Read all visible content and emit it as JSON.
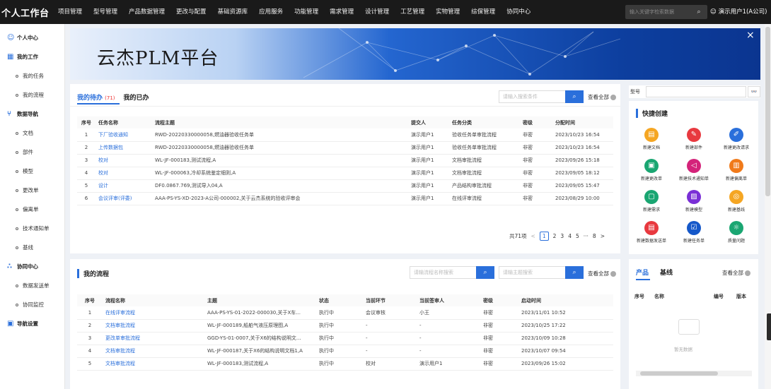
{
  "app": {
    "brand": "个人工作台",
    "user": "演示用户1(A公司)"
  },
  "nav": [
    "项目管理",
    "型号管理",
    "产品数据管理",
    "更改与配置",
    "基础资源库",
    "应用服务",
    "功能管理",
    "需求管理",
    "设计管理",
    "工艺管理",
    "实物管理",
    "综保管理",
    "协同中心"
  ],
  "search": {
    "placeholder": "输入关键字检索数据"
  },
  "sidebar": [
    {
      "label": "个人中心",
      "type": "group",
      "icon": "user-icon"
    },
    {
      "label": "我的工作",
      "type": "group",
      "icon": "calendar-icon"
    },
    {
      "label": "我的任务",
      "type": "sub"
    },
    {
      "label": "我的流程",
      "type": "sub"
    },
    {
      "label": "数据导航",
      "type": "group",
      "icon": "tree-icon"
    },
    {
      "label": "文档",
      "type": "sub"
    },
    {
      "label": "部件",
      "type": "sub"
    },
    {
      "label": "模型",
      "type": "sub"
    },
    {
      "label": "更改单",
      "type": "sub"
    },
    {
      "label": "偏离单",
      "type": "sub"
    },
    {
      "label": "技术通知单",
      "type": "sub"
    },
    {
      "label": "基线",
      "type": "sub"
    },
    {
      "label": "协同中心",
      "type": "group",
      "icon": "share-icon"
    },
    {
      "label": "数据发送单",
      "type": "sub"
    },
    {
      "label": "协同监控",
      "type": "sub"
    },
    {
      "label": "导航设置",
      "type": "group",
      "icon": "grid-icon"
    }
  ],
  "banner": {
    "title": "云杰PLM平台",
    "close": "×"
  },
  "todo": {
    "tab_todo": "我的待办",
    "todo_count": "(71)",
    "tab_done": "我的已办",
    "search_placeholder": "请输入搜索条件",
    "view_all": "查看全部",
    "columns": [
      "序号",
      "任务名称",
      "流程主题",
      "提交人",
      "任务分类",
      "密级",
      "分配时间"
    ],
    "rows": [
      [
        "1",
        "下厂验收通知",
        "RWD-20220330000058,燃油器验收任务单",
        "演示用户1",
        "验收任务单审批流程",
        "非密",
        "2023/10/23 16:54"
      ],
      [
        "2",
        "上传数据包",
        "RWD-20220330000058,燃油器验收任务单",
        "演示用户1",
        "验收任务单审批流程",
        "非密",
        "2023/10/23 16:54"
      ],
      [
        "3",
        "校对",
        "WL-JF-000183,测试流程,A",
        "演示用户1",
        "文档审批流程",
        "非密",
        "2023/09/26 15:18"
      ],
      [
        "4",
        "校对",
        "WL-JF-000063,冷却系统鉴定细则,A",
        "演示用户1",
        "文档审批流程",
        "非密",
        "2023/09/05 18:12"
      ],
      [
        "5",
        "设计",
        "DF0.0867.769,测试导入04,A",
        "演示用户1",
        "产品结构审批流程",
        "非密",
        "2023/09/05 15:47"
      ],
      [
        "6",
        "会议评审(评委)",
        "AAA-PS-YS-XD-2023-A公司-000002,关于云杰系统的验收评审会",
        "演示用户1",
        "在线评审流程",
        "非密",
        "2023/08/29 10:00"
      ]
    ],
    "pager": {
      "total": "共71项",
      "prev": "<",
      "pages": [
        "1",
        "2",
        "3",
        "4",
        "5"
      ],
      "ellipsis": "···",
      "last": "8",
      "next": ">"
    }
  },
  "flow": {
    "title": "我的流程",
    "search1_placeholder": "请输流程名称搜索",
    "search2_placeholder": "请输主题搜索",
    "view_all": "查看全部",
    "columns": [
      "序号",
      "流程名称",
      "主题",
      "状态",
      "当前环节",
      "当前签审人",
      "密级",
      "启动时间"
    ],
    "rows": [
      [
        "1",
        "在线评审流程",
        "AAA-PS-YS-01-2022-000030,关于X车...",
        "执行中",
        "会议审核",
        "小王",
        "非密",
        "2023/11/01 10:52"
      ],
      [
        "2",
        "文档审批流程",
        "WL-JF-000189,船舶气液压原理图,A",
        "执行中",
        "-",
        "-",
        "非密",
        "2023/10/25 17:22"
      ],
      [
        "3",
        "更改单审批流程",
        "GGD-YS-01-0007,关于X6的结构说明文...",
        "执行中",
        "-",
        "-",
        "非密",
        "2023/10/09 10:28"
      ],
      [
        "4",
        "文档审批流程",
        "WL-JF-000187,关于X6的结构说明文档1,A",
        "执行中",
        "-",
        "-",
        "非密",
        "2023/10/07 09:54"
      ],
      [
        "5",
        "文档审批流程",
        "WL-JF-000183,测试流程,A",
        "执行中",
        "校对",
        "演示用户1",
        "非密",
        "2023/09/26 15:02"
      ]
    ]
  },
  "model": {
    "label": "型号",
    "btn": "👓"
  },
  "quick": {
    "title": "快捷创建",
    "items": [
      {
        "label": "新建文档",
        "color": "#f5a623",
        "glyph": "▤",
        "icon": "document-icon"
      },
      {
        "label": "新建部件",
        "color": "#e8393f",
        "glyph": "✎",
        "icon": "part-icon"
      },
      {
        "label": "新建更改请求",
        "color": "#2a6fdb",
        "glyph": "✐",
        "icon": "edit-icon"
      },
      {
        "label": "新建更改单",
        "color": "#1aa672",
        "glyph": "▣",
        "icon": "change-icon"
      },
      {
        "label": "新建技术通知单",
        "color": "#d4237a",
        "glyph": "◁",
        "icon": "notice-icon"
      },
      {
        "label": "新建偏离单",
        "color": "#f07a1a",
        "glyph": "▥",
        "icon": "deviation-icon"
      },
      {
        "label": "新建需求",
        "color": "#1aa672",
        "glyph": "▢",
        "icon": "requirement-icon"
      },
      {
        "label": "新建模型",
        "color": "#7a2fd6",
        "glyph": "▨",
        "icon": "model-icon"
      },
      {
        "label": "新建基线",
        "color": "#f5a623",
        "glyph": "◎",
        "icon": "baseline-icon"
      },
      {
        "label": "新建数据发送单",
        "color": "#e8393f",
        "glyph": "▤",
        "icon": "send-icon"
      },
      {
        "label": "新建任务单",
        "color": "#1558c9",
        "glyph": "☑",
        "icon": "task-icon"
      },
      {
        "label": "质量问题",
        "color": "#1aa672",
        "glyph": "☼",
        "icon": "quality-icon"
      }
    ]
  },
  "prod": {
    "tab_product": "产品",
    "tab_baseline": "基线",
    "view_all": "查看全部",
    "columns": [
      "序号",
      "名称",
      "编号",
      "版本"
    ],
    "empty": "暂无数据"
  }
}
